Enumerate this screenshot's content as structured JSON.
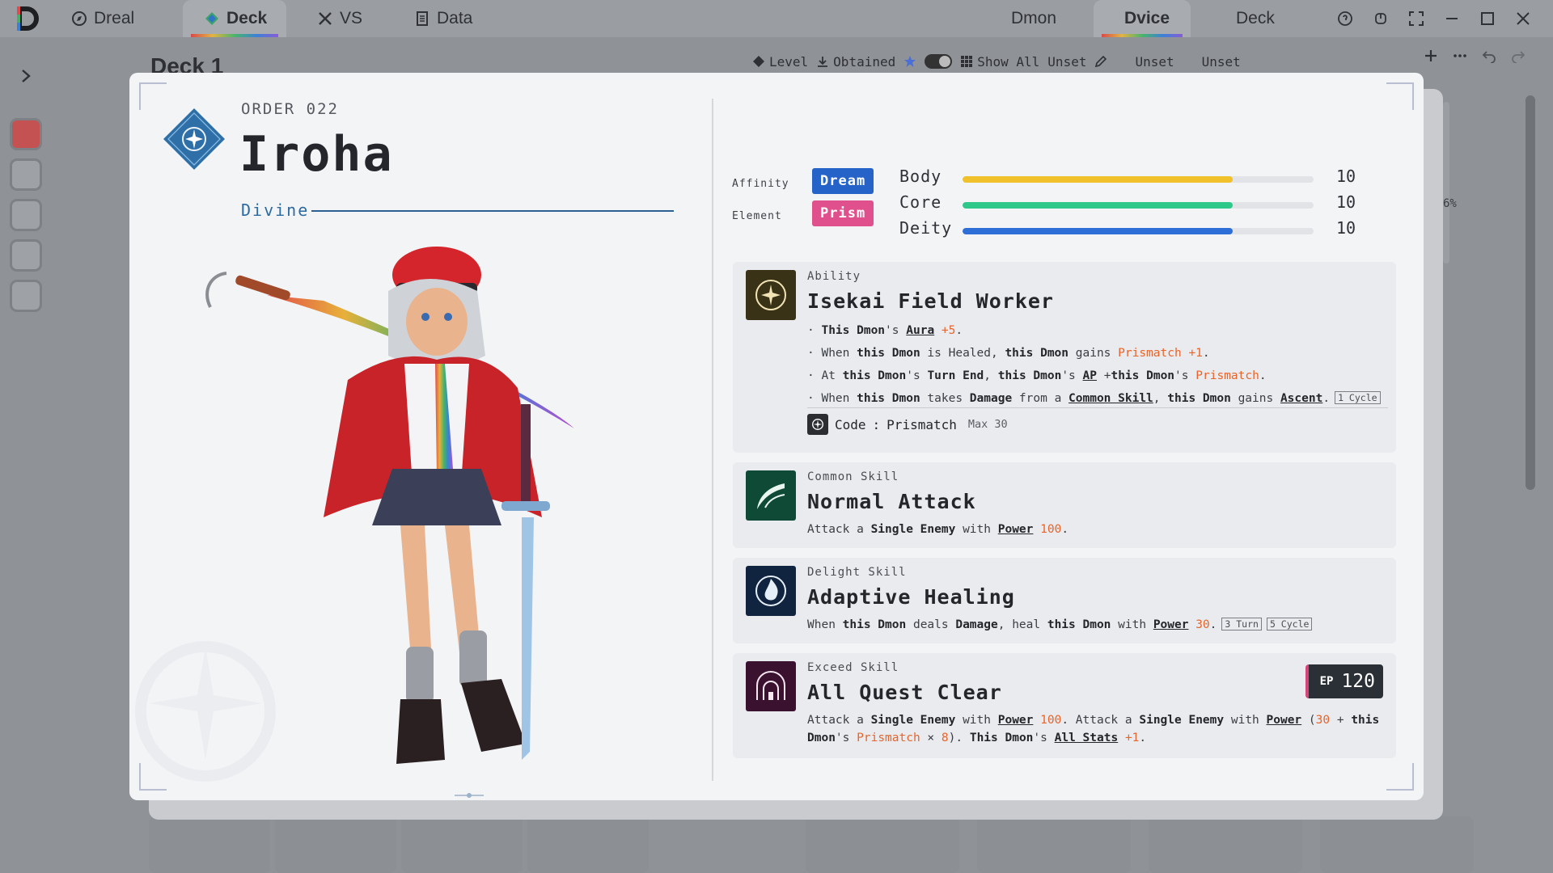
{
  "topbar": {
    "tabs_left": [
      {
        "label": "Dreal",
        "icon": "compass-icon"
      },
      {
        "label": "Deck",
        "icon": "diamond-icon"
      },
      {
        "label": "VS",
        "icon": "crossed-swords-icon"
      },
      {
        "label": "Data",
        "icon": "document-icon"
      }
    ],
    "tabs_right": [
      {
        "label": "Dmon"
      },
      {
        "label": "Dvice"
      },
      {
        "label": "Deck"
      }
    ]
  },
  "background": {
    "deck_title": "Deck 1",
    "toolbar": {
      "level": "Level",
      "obtained": "Obtained",
      "show_all": "Show All",
      "unset_1": "Unset",
      "unset_2": "Unset",
      "unset_3": "Unset"
    },
    "percent": "6%"
  },
  "card": {
    "order": "ORDER 022",
    "name": "Iroha",
    "class": "Divine",
    "affinity_label": "Affinity",
    "affinity_value": "Dream",
    "element_label": "Element",
    "element_value": "Prism",
    "stats": [
      {
        "name": "Body",
        "value": "10",
        "fill": 0.77,
        "color": "#f0c12a"
      },
      {
        "name": "Core",
        "value": "10",
        "fill": 0.77,
        "color": "#2ec98a"
      },
      {
        "name": "Deity",
        "value": "10",
        "fill": 0.77,
        "color": "#2d6fd6"
      }
    ]
  },
  "ability": {
    "kind": "Ability",
    "title": "Isekai Field Worker",
    "code_label": "Code",
    "code_value": "Prismatch",
    "code_max": "Max 30"
  },
  "common_skill": {
    "kind": "Common Skill",
    "title": "Normal Attack"
  },
  "delight_skill": {
    "kind": "Delight Skill",
    "title": "Adaptive Healing"
  },
  "exceed_skill": {
    "kind": "Exceed Skill",
    "title": "All Quest Clear",
    "ep_label": "EP",
    "ep_value": "120"
  },
  "colors": {
    "dream": "#2563c8",
    "prism": "#e0508c",
    "accent_orange": "#e8642a"
  }
}
